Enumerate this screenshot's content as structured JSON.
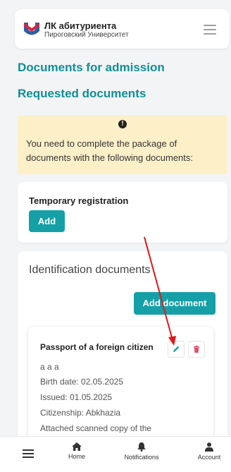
{
  "header": {
    "title": "ЛК абитуриента",
    "subtitle": "Пироговский Университет"
  },
  "page": {
    "documents_heading": "Documents for admission",
    "requested_heading": "Requested documents"
  },
  "alert": {
    "icon": "exclamation-icon",
    "text": "You need to complete the package of documents with the following documents:"
  },
  "temp_registration": {
    "title": "Temporary registration",
    "add_label": "Add"
  },
  "identification": {
    "title": "Identification documents",
    "add_document_label": "Add document",
    "document": {
      "title": "Passport of a foreign citizen",
      "name": "a a a",
      "birth_date": "Birth date: 02.05.2025",
      "issued": "Issued: 01.05.2025",
      "citizenship": "Citizenship: Abkhazia",
      "attached": "Attached scanned copy of the"
    }
  },
  "bottom_nav": {
    "home": "Home",
    "notifications": "Notifications",
    "account": "Account"
  },
  "colors": {
    "accent": "#15a0a8",
    "heading": "#0e8f97",
    "alert_bg": "#fdf0c9",
    "danger": "#e0506a",
    "annotation_arrow": "#e3151a"
  }
}
